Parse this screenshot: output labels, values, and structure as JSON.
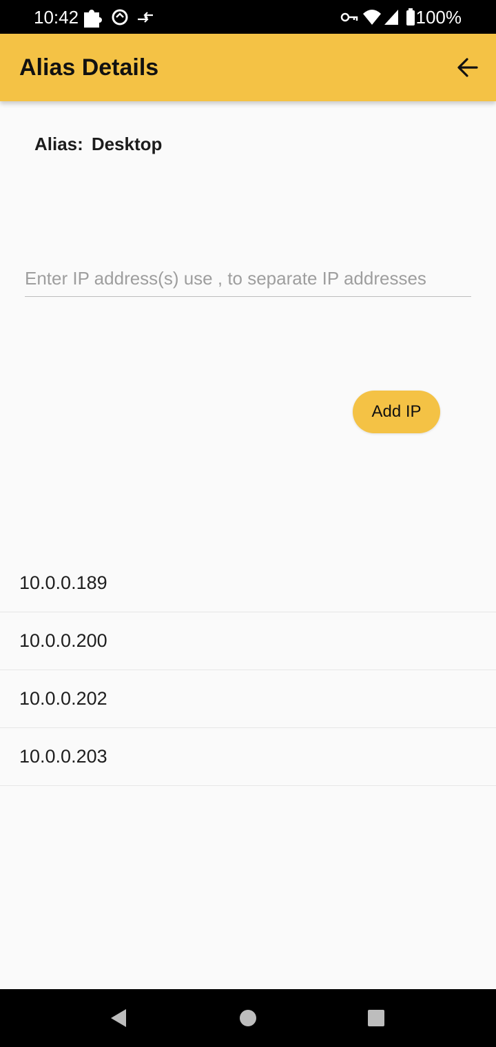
{
  "status_bar": {
    "time": "10:42",
    "battery": "100%",
    "left_icons": [
      "puzzle-icon",
      "sync-icon",
      "data-transfer-icon"
    ],
    "right_icons": [
      "vpn-key-icon",
      "wifi-icon",
      "signal-icon",
      "battery-icon"
    ]
  },
  "app_bar": {
    "title": "Alias Details",
    "back_icon": "arrow-back-icon",
    "background": "#f4c245"
  },
  "alias": {
    "label": "Alias:",
    "value": "Desktop"
  },
  "ip_input": {
    "value": "",
    "placeholder": "Enter IP address(s) use , to separate IP addresses"
  },
  "add_button": {
    "label": "Add IP",
    "color": "#f4c245"
  },
  "ip_list": [
    {
      "ip": "10.0.0.189"
    },
    {
      "ip": "10.0.0.200"
    },
    {
      "ip": "10.0.0.202"
    },
    {
      "ip": "10.0.0.203"
    }
  ],
  "nav_bar": {
    "icons": [
      "back-triangle-icon",
      "home-circle-icon",
      "recents-square-icon"
    ]
  }
}
